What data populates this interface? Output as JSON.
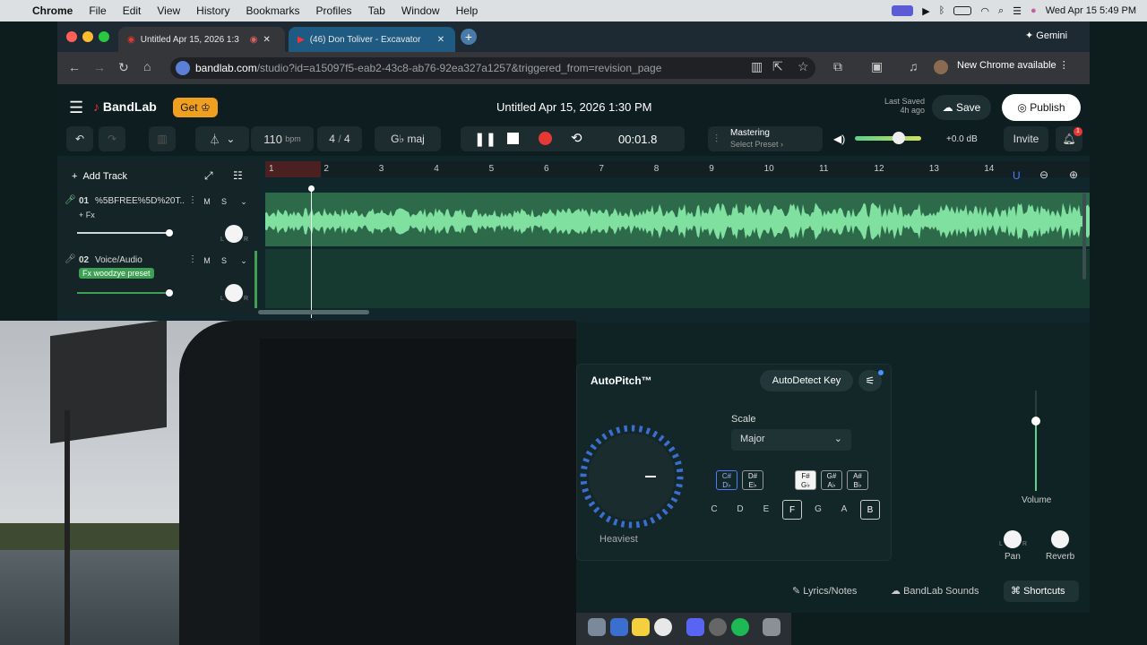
{
  "menubar": {
    "app": "Chrome",
    "items": [
      "File",
      "Edit",
      "View",
      "History",
      "Bookmarks",
      "Profiles",
      "Tab",
      "Window",
      "Help"
    ],
    "datetime": "Wed Apr 15  5:49 PM"
  },
  "browser": {
    "tabs": [
      {
        "title": "Untitled Apr 15, 2026 1:3"
      },
      {
        "title": "(46) Don Toliver - Excavator"
      }
    ],
    "gemini_label": "Gemini",
    "url_host": "bandlab.com",
    "url_path": "/studio?id=a15097f5-eab2-43c8-ab76-92ea327a1257&triggered_from=revision_page",
    "update_label": "New Chrome available"
  },
  "bandlab": {
    "logo": "BandLab",
    "get_label": "Get",
    "project_title": "Untitled Apr 15, 2026 1:30 PM",
    "last_saved_label": "Last Saved",
    "last_saved_time": "4h ago",
    "save_label": "Save",
    "publish_label": "Publish",
    "tempo": "110",
    "tempo_unit": "bpm",
    "time_sig_num": "4",
    "time_sig_sep": "/",
    "time_sig_den": "4",
    "key": "G♭ maj",
    "time": "00:01.8",
    "mastering_label": "Mastering",
    "mastering_preset": "Select Preset",
    "master_volume": "+0.0 dB",
    "invite_label": "Invite",
    "notification_count": "1",
    "add_track_label": "Add Track",
    "ruler": [
      "1",
      "2",
      "3",
      "4",
      "5",
      "6",
      "7",
      "8",
      "9",
      "10",
      "11",
      "12",
      "13",
      "14"
    ],
    "tracks": [
      {
        "number": "01",
        "name": "%5BFREE%5D%20T...",
        "fx": "+ Fx",
        "m": "M",
        "s": "S",
        "pan_l": "L",
        "pan_r": "R"
      },
      {
        "number": "02",
        "name": "Voice/Audio",
        "fx": "Fx woodzye preset",
        "m": "M",
        "s": "S",
        "pan_l": "L",
        "pan_r": "R"
      }
    ]
  },
  "autopitch": {
    "title": "AutoPitch™",
    "autodetect_label": "AutoDetect Key",
    "dial_label": "Heaviest",
    "scale_label": "Scale",
    "scale_value": "Major",
    "sharp_keys": [
      {
        "top": "C#",
        "bottom": "D♭"
      },
      {
        "top": "D#",
        "bottom": "E♭"
      },
      {
        "top": "F#",
        "bottom": "G♭"
      },
      {
        "top": "G#",
        "bottom": "A♭"
      },
      {
        "top": "A#",
        "bottom": "B♭"
      }
    ],
    "natural_keys": [
      "C",
      "D",
      "E",
      "F",
      "G",
      "A",
      "B"
    ],
    "volume_label": "Volume",
    "pan_label": "Pan",
    "reverb_label": "Reverb",
    "pan_l": "L",
    "pan_r": "R"
  },
  "footer": {
    "lyrics_label": "Lyrics/Notes",
    "sounds_label": "BandLab Sounds",
    "shortcuts_label": "Shortcuts"
  },
  "colors": {
    "accent_orange": "#f0a020",
    "wave_green": "#7fe0a0",
    "record_red": "#e53935",
    "publish_white": "#ffffff"
  }
}
